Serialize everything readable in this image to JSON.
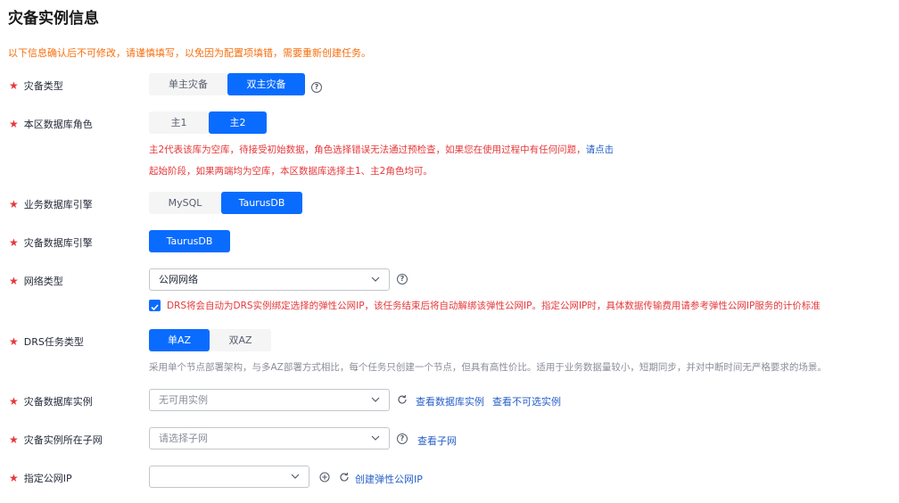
{
  "page": {
    "title": "灾备实例信息",
    "notice": "以下信息确认后不可修改，请谨慎填写，以免因为配置项填错，需要重新创建任务。"
  },
  "required_mark": "★",
  "fields": {
    "dr_type": {
      "label": "灾备类型",
      "options": [
        "单主灾备",
        "双主灾备"
      ],
      "selected": "双主灾备"
    },
    "local_role": {
      "label": "本区数据库角色",
      "options": [
        "主1",
        "主2"
      ],
      "selected": "主2",
      "hint_line1": "主2代表该库为空库，待接受初始数据，角色选择错误无法通过预检查，如果您在使用过程中有任何问题，",
      "hint_link": "请点击",
      "hint_line2": "起始阶段，如果两端均为空库，本区数据库选择主1、主2角色均可。"
    },
    "business_engine": {
      "label": "业务数据库引擎",
      "options": [
        "MySQL",
        "TaurusDB"
      ],
      "selected": "TaurusDB"
    },
    "dr_engine": {
      "label": "灾备数据库引擎",
      "options": [
        "TaurusDB"
      ],
      "selected": "TaurusDB"
    },
    "network_type": {
      "label": "网络类型",
      "value": "公网网络",
      "checkbox_text": "DRS将会自动为DRS实例绑定选择的弹性公网IP，该任务结束后将自动解绑该弹性公网IP。指定公网IP时，具体数据传输费用请参考弹性公网IP服务的计价标准",
      "checked": true
    },
    "drs_task_type": {
      "label": "DRS任务类型",
      "options": [
        "单AZ",
        "双AZ"
      ],
      "selected": "单AZ",
      "hint": "采用单个节点部署架构，与多AZ部署方式相比，每个任务只创建一个节点，但具有高性价比。适用于业务数据量较小，短期同步，并对中断时间无严格要求的场景。"
    },
    "dr_instance": {
      "label": "灾备数据库实例",
      "placeholder": "无可用实例",
      "link_view": "查看数据库实例",
      "link_unselectable": "查看不可选实例"
    },
    "dr_subnet": {
      "label": "灾备实例所在子网",
      "placeholder": "请选择子网",
      "link_view": "查看子网"
    },
    "public_ip": {
      "label": "指定公网IP",
      "value": "",
      "link_create": "创建弹性公网IP"
    }
  }
}
